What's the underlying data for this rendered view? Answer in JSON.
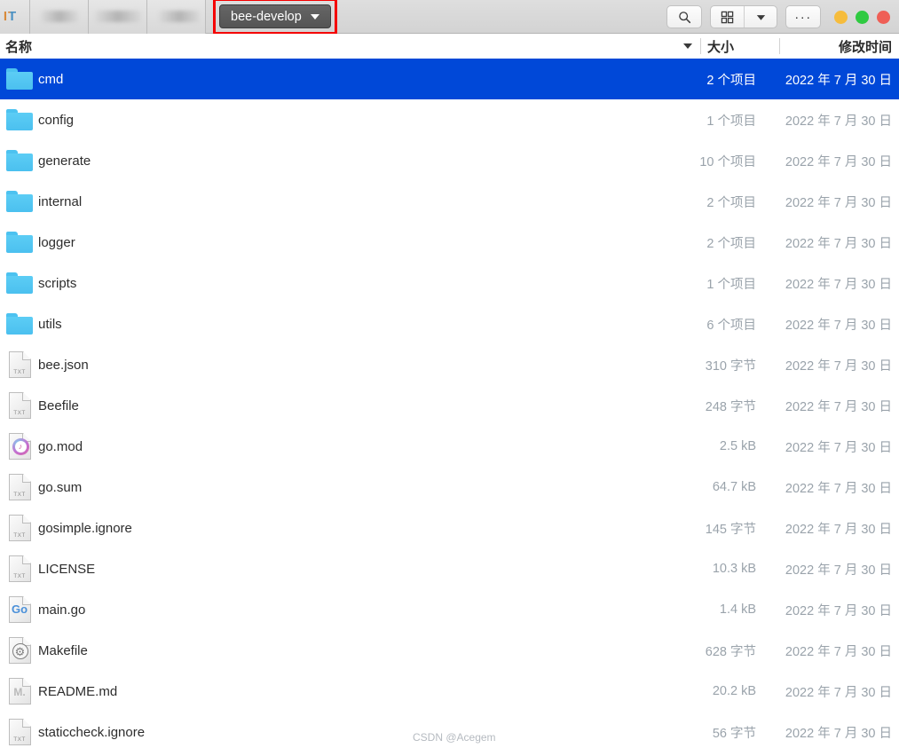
{
  "titlebar": {
    "logo_text": "IT",
    "blurred_tabs": [
      "",
      "",
      ""
    ],
    "path_button": {
      "label": "bee-develop",
      "dropdown_icon": "caret-down-icon",
      "highlight_color": "#f40000"
    },
    "toolbar_buttons": [
      {
        "name": "search-button",
        "icon": "search-icon"
      },
      {
        "name": "view-grid-button",
        "icon": "grid-view-icon"
      },
      {
        "name": "view-options-button",
        "icon": "caret-down-icon"
      },
      {
        "name": "more-options-button",
        "icon": "ellipsis-icon",
        "label": "···"
      }
    ],
    "window_controls": [
      {
        "name": "minimize-button",
        "color": "#f6bc3c"
      },
      {
        "name": "maximize-button",
        "color": "#2fca41"
      },
      {
        "name": "close-button",
        "color": "#ef5f56"
      }
    ]
  },
  "columns": {
    "name": "名称",
    "size": "大小",
    "modified": "修改时间",
    "sort_icon": "sort-descending-icon"
  },
  "files": [
    {
      "name": "cmd",
      "icon": "folder-icon",
      "size": "2 个项目",
      "modified": "2022 年 7 月 30 日",
      "selected": true
    },
    {
      "name": "config",
      "icon": "folder-icon",
      "size": "1 个项目",
      "modified": "2022 年 7 月 30 日",
      "selected": false
    },
    {
      "name": "generate",
      "icon": "folder-icon",
      "size": "10 个项目",
      "modified": "2022 年 7 月 30 日",
      "selected": false
    },
    {
      "name": "internal",
      "icon": "folder-icon",
      "size": "2 个项目",
      "modified": "2022 年 7 月 30 日",
      "selected": false
    },
    {
      "name": "logger",
      "icon": "folder-icon",
      "size": "2 个项目",
      "modified": "2022 年 7 月 30 日",
      "selected": false
    },
    {
      "name": "scripts",
      "icon": "folder-icon",
      "size": "1 个项目",
      "modified": "2022 年 7 月 30 日",
      "selected": false
    },
    {
      "name": "utils",
      "icon": "folder-icon",
      "size": "6 个项目",
      "modified": "2022 年 7 月 30 日",
      "selected": false
    },
    {
      "name": "bee.json",
      "icon": "text-file-icon",
      "badge": "TXT",
      "size": "310 字节",
      "modified": "2022 年 7 月 30 日",
      "selected": false
    },
    {
      "name": "Beefile",
      "icon": "text-file-icon",
      "badge": "TXT",
      "size": "248 字节",
      "modified": "2022 年 7 月 30 日",
      "selected": false
    },
    {
      "name": "go.mod",
      "icon": "music-file-icon",
      "badge": "",
      "size": "2.5 kB",
      "modified": "2022 年 7 月 30 日",
      "selected": false
    },
    {
      "name": "go.sum",
      "icon": "text-file-icon",
      "badge": "TXT",
      "size": "64.7 kB",
      "modified": "2022 年 7 月 30 日",
      "selected": false
    },
    {
      "name": "gosimple.ignore",
      "icon": "text-file-icon",
      "badge": "TXT",
      "size": "145 字节",
      "modified": "2022 年 7 月 30 日",
      "selected": false
    },
    {
      "name": "LICENSE",
      "icon": "text-file-icon",
      "badge": "TXT",
      "size": "10.3 kB",
      "modified": "2022 年 7 月 30 日",
      "selected": false
    },
    {
      "name": "main.go",
      "icon": "go-file-icon",
      "badge": "Go",
      "size": "1.4 kB",
      "modified": "2022 年 7 月 30 日",
      "selected": false
    },
    {
      "name": "Makefile",
      "icon": "makefile-icon",
      "badge": "",
      "size": "628 字节",
      "modified": "2022 年 7 月 30 日",
      "selected": false
    },
    {
      "name": "README.md",
      "icon": "markdown-file-icon",
      "badge": "M.",
      "size": "20.2 kB",
      "modified": "2022 年 7 月 30 日",
      "selected": false
    },
    {
      "name": "staticcheck.ignore",
      "icon": "text-file-icon",
      "badge": "TXT",
      "size": "56 字节",
      "modified": "2022 年 7 月 30 日",
      "selected": false
    }
  ],
  "watermark": {
    "text": "CSDN @Acegem"
  }
}
